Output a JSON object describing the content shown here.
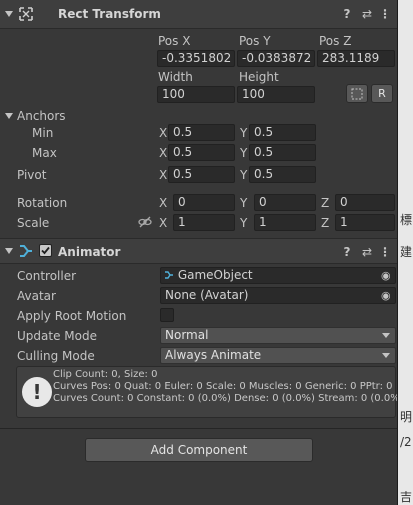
{
  "rect_transform": {
    "title": "Rect Transform",
    "pos_x_label": "Pos X",
    "pos_y_label": "Pos Y",
    "pos_z_label": "Pos Z",
    "pos_x": "-0.3351802",
    "pos_y": "-0.0383872",
    "pos_z": "283.1189",
    "width_label": "Width",
    "height_label": "Height",
    "width": "100",
    "height": "100",
    "raw_button_label": "R",
    "anchors_label": "Anchors",
    "min_label": "Min",
    "max_label": "Max",
    "min_x": "0.5",
    "min_y": "0.5",
    "max_x": "0.5",
    "max_y": "0.5",
    "pivot_label": "Pivot",
    "pivot_x": "0.5",
    "pivot_y": "0.5",
    "rotation_label": "Rotation",
    "rot_x": "0",
    "rot_y": "0",
    "rot_z": "0",
    "scale_label": "Scale",
    "scale_x": "1",
    "scale_y": "1",
    "scale_z": "1",
    "axis_x": "X",
    "axis_y": "Y",
    "axis_z": "Z"
  },
  "animator": {
    "title": "Animator",
    "enabled": true,
    "controller_label": "Controller",
    "controller_value": "GameObject",
    "avatar_label": "Avatar",
    "avatar_value": "None (Avatar)",
    "apply_root_motion_label": "Apply Root Motion",
    "update_mode_label": "Update Mode",
    "update_mode_value": "Normal",
    "culling_mode_label": "Culling Mode",
    "culling_mode_value": "Always Animate",
    "info_line1": "Clip Count: 0, Size: 0",
    "info_line2": "Curves Pos: 0 Quat: 0 Euler: 0 Scale: 0 Muscles: 0 Generic: 0 PPtr: 0",
    "info_line3": "Curves Count: 0 Constant: 0 (0.0%) Dense: 0 (0.0%) Stream: 0 (0.0%)"
  },
  "footer": {
    "add_component_label": "Add Component"
  },
  "icons": {
    "help": "?",
    "preset": "⇄",
    "menu": "⋮",
    "target": "◉",
    "warning": "!"
  },
  "edge_glyphs": [
    "標",
    "建",
    "明",
    "/2",
    "吉"
  ]
}
